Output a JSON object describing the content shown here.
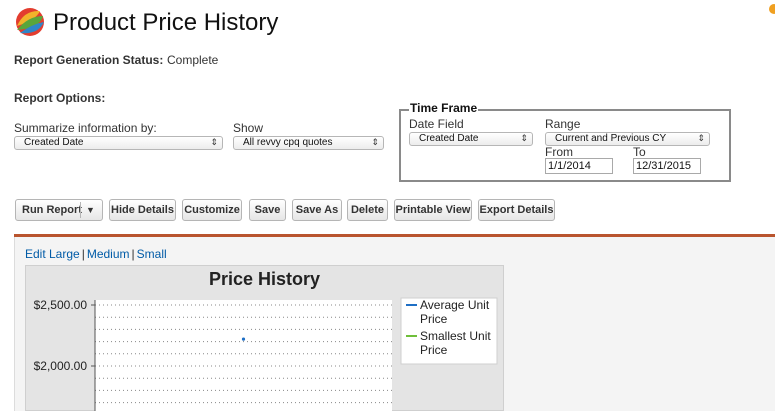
{
  "header": {
    "title": "Product Price History"
  },
  "status": {
    "label": "Report Generation Status:",
    "value": "Complete"
  },
  "options": {
    "heading": "Report Options:",
    "summarize": {
      "label": "Summarize information by:",
      "value": "Created Date"
    },
    "show": {
      "label": "Show",
      "value": "All revvy cpq quotes"
    },
    "time_frame": {
      "legend": "Time Frame",
      "date_field": {
        "label": "Date Field",
        "value": "Created Date"
      },
      "range": {
        "label": "Range",
        "value": "Current and Previous CY"
      },
      "from": {
        "label": "From",
        "value": "1/1/2014"
      },
      "to": {
        "label": "To",
        "value": "12/31/2015"
      }
    }
  },
  "toolbar": {
    "run_report": "Run Report",
    "hide_details": "Hide Details",
    "customize": "Customize",
    "save": "Save",
    "save_as": "Save As",
    "delete": "Delete",
    "printable_view": "Printable View",
    "export_details": "Export Details"
  },
  "chart_sizes": {
    "large": "Edit Large",
    "medium": "Medium",
    "small": "Small"
  },
  "colors": {
    "report_bar": "#b9542e",
    "link": "#015ba7",
    "series_average": "#1f6fc5",
    "series_smallest": "#6fbf3a"
  },
  "chart_data": {
    "type": "line",
    "title": "Price History",
    "xlabel": "",
    "ylabel": "",
    "yticks": [
      "$2,500.00",
      "$2,000.00"
    ],
    "ytick_values": [
      2500,
      2000
    ],
    "ylim": [
      1600,
      2500
    ],
    "grid": true,
    "legend_position": "top-right",
    "series": [
      {
        "name": "Average Unit Price",
        "points": [
          {
            "x": 0.5,
            "y": 2220
          }
        ]
      },
      {
        "name": "Smallest Unit Price",
        "points": []
      }
    ]
  }
}
